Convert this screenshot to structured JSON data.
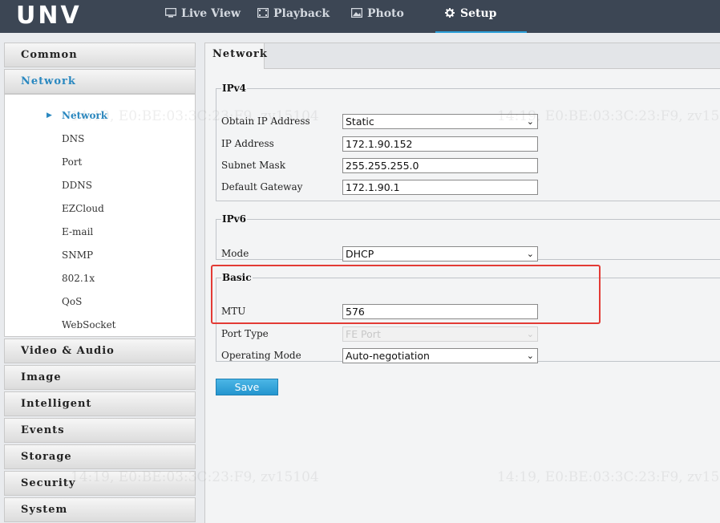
{
  "app": {
    "logo": "UNV"
  },
  "nav": [
    {
      "label": "Live View",
      "icon": "monitor-icon"
    },
    {
      "label": "Playback",
      "icon": "film-icon"
    },
    {
      "label": "Photo",
      "icon": "picture-icon"
    },
    {
      "label": "Setup",
      "icon": "gear-icon",
      "active": true
    }
  ],
  "sidebar": {
    "categories": {
      "common": "Common",
      "network": "Network",
      "video_audio": "Video & Audio",
      "image": "Image",
      "intelligent": "Intelligent",
      "events": "Events",
      "storage": "Storage",
      "security": "Security",
      "system": "System"
    },
    "network_items": [
      "Network",
      "DNS",
      "Port",
      "DDNS",
      "EZCloud",
      "E-mail",
      "SNMP",
      "802.1x",
      "QoS",
      "WebSocket"
    ]
  },
  "main": {
    "tab": "Network",
    "ipv4": {
      "legend": "IPv4",
      "obtain_label": "Obtain IP Address",
      "obtain_value": "Static",
      "ip_label": "IP Address",
      "ip_value": "172.1.90.152",
      "mask_label": "Subnet Mask",
      "mask_value": "255.255.255.0",
      "gateway_label": "Default Gateway",
      "gateway_value": "172.1.90.1"
    },
    "ipv6": {
      "legend": "IPv6",
      "mode_label": "Mode",
      "mode_value": "DHCP"
    },
    "basic": {
      "legend": "Basic",
      "mtu_label": "MTU",
      "mtu_value": "576",
      "port_type_label": "Port Type",
      "port_type_value": "FE Port",
      "op_mode_label": "Operating Mode",
      "op_mode_value": "Auto-negotiation"
    },
    "save_label": "Save"
  },
  "watermark": "14:19, E0:BE:03:3C:23:F9, zv15104",
  "colors": {
    "accent": "#2a88c0",
    "topbar": "#3c4654",
    "highlight": "#e33b35",
    "save_button": "#2495cf"
  }
}
